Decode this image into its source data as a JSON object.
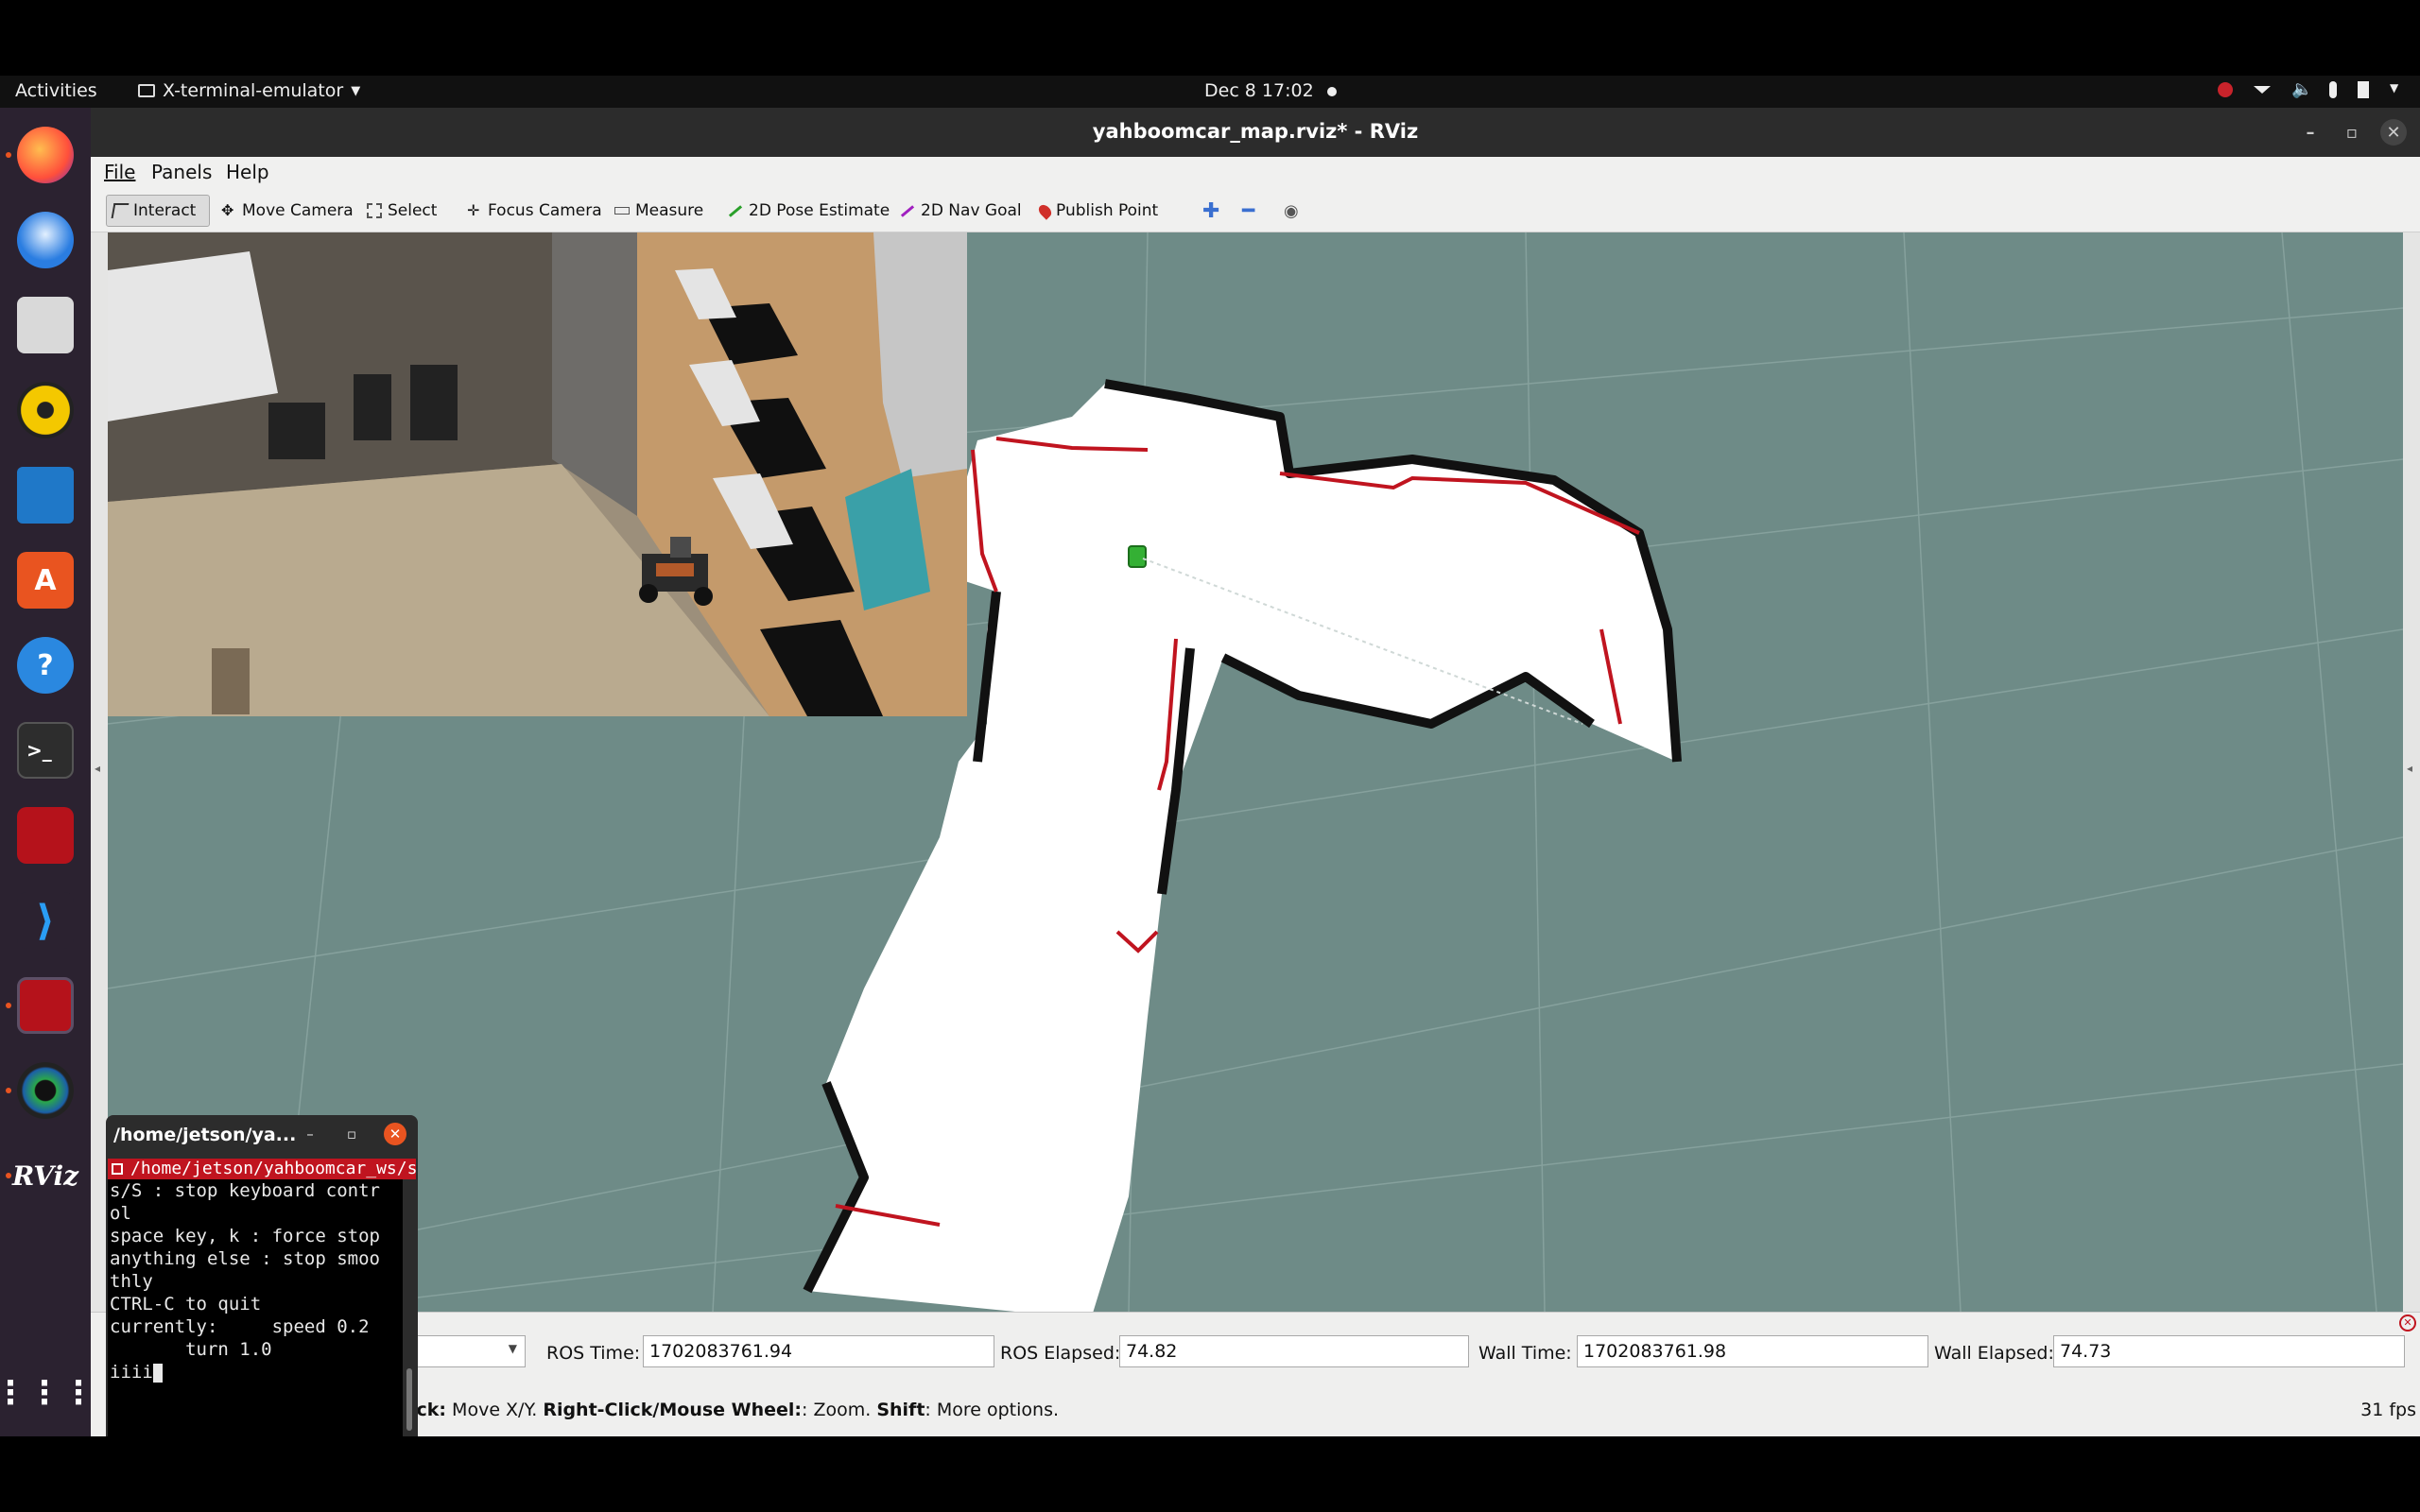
{
  "topbar": {
    "activities": "Activities",
    "app_menu": "X-terminal-emulator",
    "clock": "Dec 8  17:02"
  },
  "dock": {
    "items": [
      "firefox-icon",
      "thunderbird-icon",
      "files-icon",
      "rhythmbox-icon",
      "writer-icon",
      "software-icon",
      "help-icon",
      "terminal-icon",
      "rviz-config-icon",
      "vscode-icon",
      "rviz-config-icon",
      "cheese-icon",
      "rviz-icon",
      "show-apps-icon"
    ],
    "rviz_label": "RViz"
  },
  "window": {
    "title": "yahboomcar_map.rviz* - RViz"
  },
  "menu": {
    "file": "File",
    "panels": "Panels",
    "help": "Help"
  },
  "toolbar": {
    "interact": "Interact",
    "move_camera": "Move Camera",
    "select": "Select",
    "focus_camera": "Focus Camera",
    "measure": "Measure",
    "pose_estimate": "2D Pose Estimate",
    "nav_goal": "2D Nav Goal",
    "publish_point": "Publish Point"
  },
  "time_panel": {
    "ros_time_label": "ROS Time:",
    "ros_time": "1702083761.94",
    "ros_elapsed_label": "ROS Elapsed:",
    "ros_elapsed": "74.82",
    "wall_time_label": "Wall Time:",
    "wall_time": "1702083761.98",
    "wall_elapsed_label": "Wall Elapsed:",
    "wall_elapsed": "74.73"
  },
  "status": {
    "hint_click": "ick:",
    "hint_move": " Move X/Y. ",
    "hint_right": "Right-Click/Mouse Wheel:",
    "hint_zoom": ": Zoom. ",
    "hint_shift": "Shift",
    "hint_more": ": More options.",
    "fps": "31 fps"
  },
  "terminal": {
    "title": "/home/jetson/ya...",
    "tab": "/home/jetson/yahboomcar_ws/s",
    "lines": [
      "s/S : stop keyboard contr",
      "ol",
      "space key, k : force stop",
      "anything else : stop smoo",
      "thly",
      "",
      "CTRL-C to quit",
      "",
      "currently:     speed 0.2",
      "       turn 1.0",
      "iiii"
    ]
  },
  "colors": {
    "grid_bg": "#6e8b87",
    "wall_red": "#c0141f",
    "dock_bg": "#2b2230",
    "accent": "#e95420"
  }
}
